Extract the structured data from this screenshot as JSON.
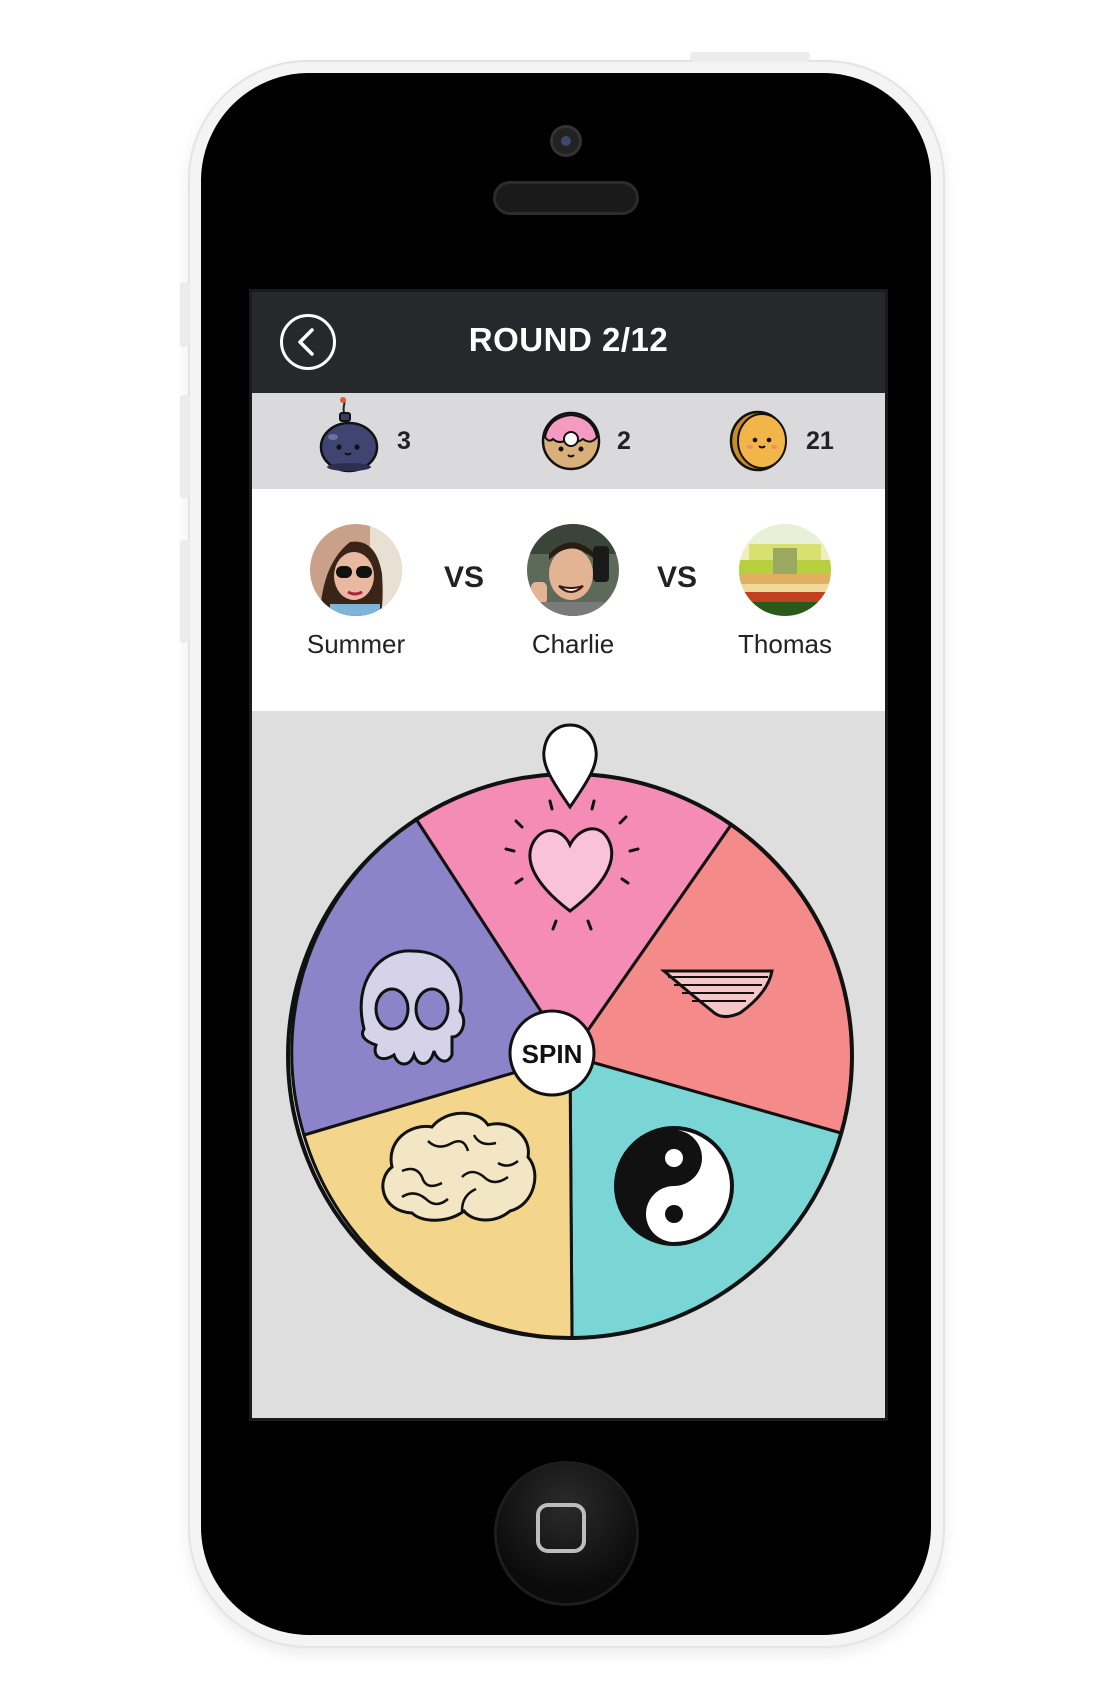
{
  "header": {
    "title": "ROUND 2/12"
  },
  "scores": [
    {
      "icon": "bomb-character-icon",
      "value": "3"
    },
    {
      "icon": "donut-character-icon",
      "value": "2"
    },
    {
      "icon": "coin-character-icon",
      "value": "21"
    }
  ],
  "players": [
    {
      "name": "Summer"
    },
    {
      "name": "Charlie"
    },
    {
      "name": "Thomas"
    }
  ],
  "vs_label": "VS",
  "wheel": {
    "spin_label": "SPIN",
    "segments": [
      {
        "icon": "heart-icon",
        "color": "#f58cb6"
      },
      {
        "icon": "underwear-icon",
        "color": "#f48a8a"
      },
      {
        "icon": "yin-yang-icon",
        "color": "#7ad5d5"
      },
      {
        "icon": "brain-icon",
        "color": "#f3d58c"
      },
      {
        "icon": "skull-icon",
        "color": "#8c83c8"
      }
    ]
  },
  "colors": {
    "topbar": "#26282c",
    "scorebar": "#dadadc",
    "wheel_bg": "#dedede"
  }
}
